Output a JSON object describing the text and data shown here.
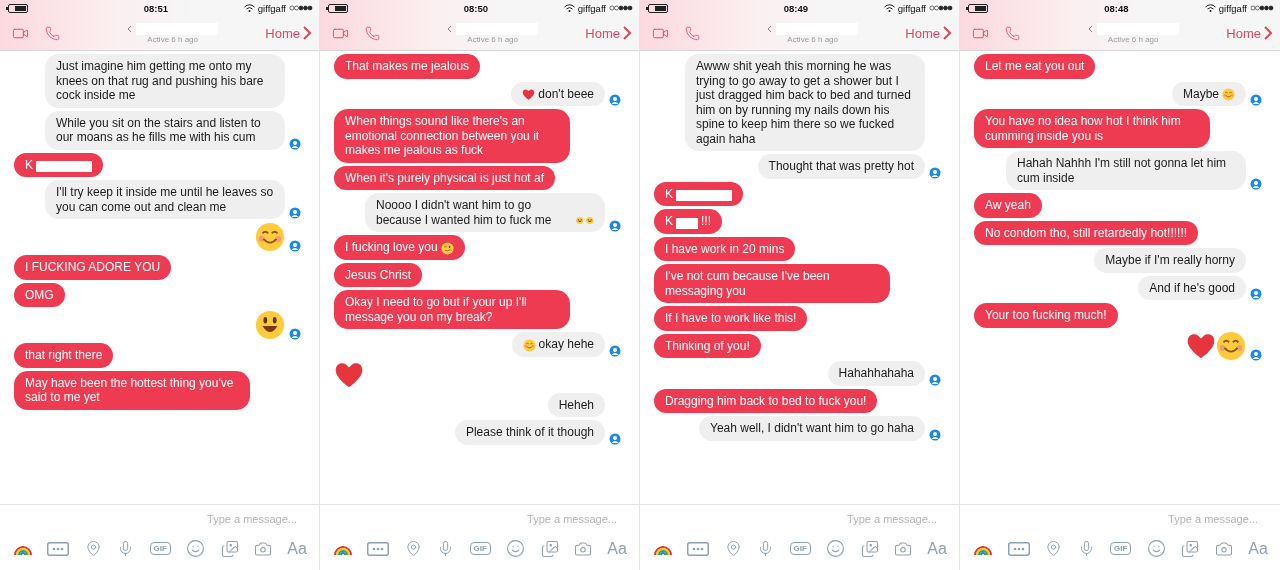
{
  "panels": [
    {
      "status": {
        "time": "08:51",
        "carrier": "giffgaff"
      },
      "header": {
        "home": "Home",
        "name_redacted": true,
        "active": "Active 6 h ago"
      },
      "messages": [
        {
          "outgoing": false,
          "kind": "text",
          "text": "Just imagine him getting me onto my knees on that rug and pushing his bare cock inside me",
          "seen": false
        },
        {
          "outgoing": false,
          "kind": "text",
          "text": "While you sit on the stairs and listen to our moans as he fills me with his cum",
          "seen": true
        },
        {
          "outgoing": true,
          "kind": "text",
          "text": "K",
          "redacted": true
        },
        {
          "outgoing": false,
          "kind": "text",
          "text": "I'll try keep it inside me until he leaves so you can come out and clean me",
          "seen": true
        },
        {
          "outgoing": false,
          "kind": "smile",
          "seen": true
        },
        {
          "outgoing": true,
          "kind": "text",
          "text": "I FUCKING ADORE YOU"
        },
        {
          "outgoing": true,
          "kind": "text",
          "text": "OMG"
        },
        {
          "outgoing": false,
          "kind": "grin",
          "seen": true
        },
        {
          "outgoing": true,
          "kind": "text",
          "text": "that right there"
        },
        {
          "outgoing": true,
          "kind": "text",
          "text": "May have been the hottest thing you've said to me yet"
        }
      ],
      "composer": {
        "placeholder": "Type a message...",
        "gif": "GIF",
        "text_button": "Aa"
      }
    },
    {
      "status": {
        "time": "08:50",
        "carrier": "giffgaff"
      },
      "header": {
        "home": "Home",
        "name_redacted": true,
        "active": "Active 6 h ago"
      },
      "messages": [
        {
          "outgoing": true,
          "kind": "text",
          "text": "That makes me jealous"
        },
        {
          "outgoing": false,
          "kind": "text",
          "text": "don't beee",
          "lead": [
            {
              "kind": "heart"
            }
          ],
          "seen": true
        },
        {
          "outgoing": true,
          "kind": "text",
          "text": "When things sound like there's an emotional connection between you it makes me jealous as fuck"
        },
        {
          "outgoing": true,
          "kind": "text",
          "text": "When it's purely physical is just hot af"
        },
        {
          "outgoing": false,
          "kind": "text",
          "text": "Noooo I didn't want him to go because I wanted him to fuck me",
          "trail": [
            {
              "kind": "laugh"
            },
            {
              "kind": "laugh"
            }
          ],
          "seen": true
        },
        {
          "outgoing": true,
          "kind": "text",
          "text": "I fucking love you",
          "trail": [
            {
              "kind": "wink"
            }
          ]
        },
        {
          "outgoing": true,
          "kind": "text",
          "text": "Jesus Christ"
        },
        {
          "outgoing": true,
          "kind": "text",
          "text": "Okay I need to go but if your up I'll message you on my break?"
        },
        {
          "outgoing": false,
          "kind": "text",
          "text": "okay hehe",
          "lead": [
            {
              "kind": "smile"
            }
          ],
          "seen": true
        },
        {
          "outgoing": true,
          "kind": "heart"
        },
        {
          "outgoing": false,
          "kind": "text",
          "text": "Heheh",
          "seen": false
        },
        {
          "outgoing": false,
          "kind": "text",
          "text": "Please think of it though",
          "seen": true
        }
      ],
      "composer": {
        "placeholder": "Type a message...",
        "gif": "GIF",
        "text_button": "Aa"
      }
    },
    {
      "status": {
        "time": "08:49",
        "carrier": "giffgaff"
      },
      "header": {
        "home": "Home",
        "name_redacted": true,
        "active": "Active 6 h ago"
      },
      "messages": [
        {
          "outgoing": false,
          "kind": "text",
          "text": "Awww shit yeah this morning he was trying to go away to get a shower but I just dragged him back to bed and turned him on by running my nails down his spine to keep him there so we fucked again haha",
          "seen": false
        },
        {
          "outgoing": false,
          "kind": "text",
          "text": "Thought that was pretty hot",
          "seen": true
        },
        {
          "outgoing": true,
          "kind": "text",
          "text": "K",
          "redacted": true
        },
        {
          "outgoing": true,
          "kind": "text",
          "text": "K",
          "redacted": true,
          "after": "!!!"
        },
        {
          "outgoing": true,
          "kind": "text",
          "text": "I have work in 20 mins"
        },
        {
          "outgoing": true,
          "kind": "text",
          "text": "I've not cum because I've been messaging you"
        },
        {
          "outgoing": true,
          "kind": "text",
          "text": "If I have to work like this!"
        },
        {
          "outgoing": true,
          "kind": "text",
          "text": "Thinking of you!"
        },
        {
          "outgoing": false,
          "kind": "text",
          "text": "Hahahhahaha",
          "seen": true
        },
        {
          "outgoing": true,
          "kind": "text",
          "text": "Dragging him back to bed to fuck you!"
        },
        {
          "outgoing": false,
          "kind": "text",
          "text": "Yeah well, I didn't want him to go haha",
          "seen": true
        }
      ],
      "composer": {
        "placeholder": "Type a message...",
        "gif": "GIF",
        "text_button": "Aa"
      }
    },
    {
      "status": {
        "time": "08:48",
        "carrier": "giffgaff"
      },
      "header": {
        "home": "Home",
        "name_redacted": true,
        "active": "Active 6 h ago"
      },
      "messages": [
        {
          "outgoing": true,
          "kind": "text",
          "text": "Let me eat you out"
        },
        {
          "outgoing": false,
          "kind": "text",
          "text": "Maybe",
          "trail": [
            {
              "kind": "smile"
            }
          ],
          "seen": true
        },
        {
          "outgoing": true,
          "kind": "text",
          "text": "You have no idea how hot I think him cumming inside you is"
        },
        {
          "outgoing": false,
          "kind": "text",
          "text": "Hahah Nahhh I'm still not gonna let him cum inside",
          "seen": true
        },
        {
          "outgoing": true,
          "kind": "text",
          "text": "Aw yeah"
        },
        {
          "outgoing": true,
          "kind": "text",
          "text": "No condom tho, still retardedly hot!!!!!!"
        },
        {
          "outgoing": false,
          "kind": "text",
          "text": "Maybe if I'm really horny",
          "seen": false
        },
        {
          "outgoing": false,
          "kind": "text",
          "text": "And if he's good",
          "seen": true
        },
        {
          "outgoing": true,
          "kind": "text",
          "text": "Your too fucking much!"
        },
        {
          "outgoing": false,
          "kind": "heart-smile",
          "seen": true
        }
      ],
      "composer": {
        "placeholder": "Type a message...",
        "gif": "GIF",
        "text_button": "Aa"
      }
    }
  ]
}
